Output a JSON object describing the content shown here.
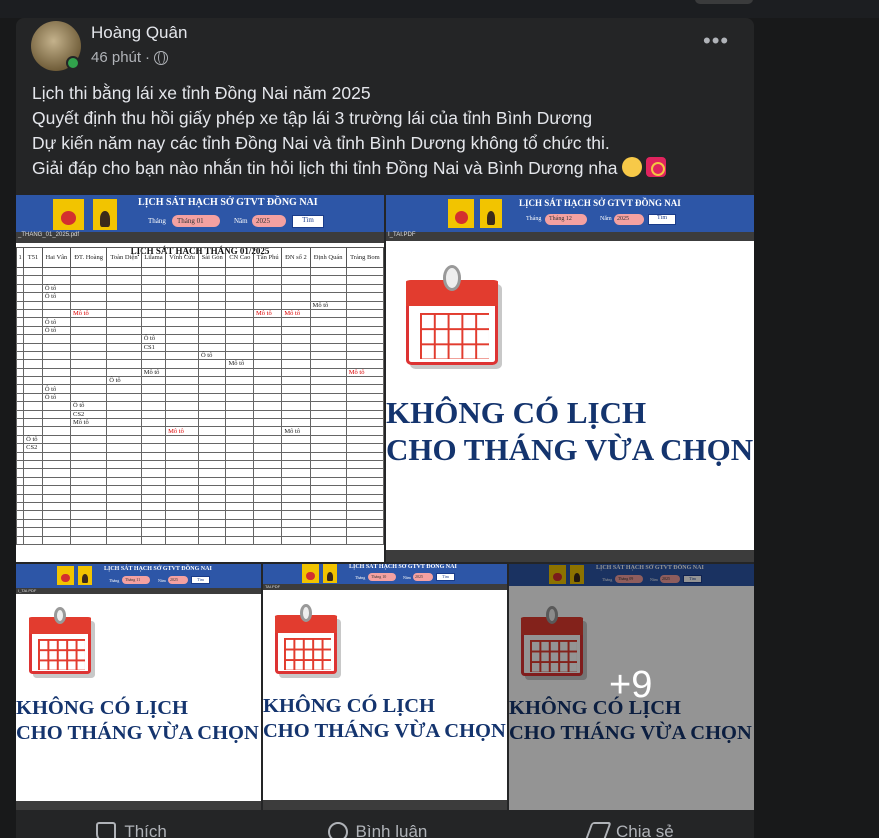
{
  "post": {
    "author": "Hoàng Quân",
    "time": "46 phút",
    "separator": "·",
    "more_label": "•••",
    "lines": [
      "Lịch thi bằng lái xe tỉnh Đồng Nai năm 2025",
      "Quyết định thu hồi giấy phép xe tập lái 3 trường lái của tỉnh Bình Dương",
      "Dự kiến năm nay các tỉnh Đồng Nai và tỉnh Bình Dương không tổ chức thi.",
      "Giải đáp cho bạn nào nhắn tin hỏi lịch thi tỉnh Đồng Nai và Bình Dương nha"
    ],
    "emojis": [
      "grin-emoji",
      "red-envelope-emoji"
    ]
  },
  "site": {
    "title": "LỊCH SÁT HẠCH SỞ GTVT ĐỒNG NAI",
    "home_btn": "Trang chủ",
    "mgr_btn": "Quản lý",
    "month_label": "Tháng",
    "year_label": "Năm",
    "search_btn": "Tìm"
  },
  "images": [
    {
      "month": "Tháng 01",
      "year": "2025",
      "file": "_THANG_01_2025.pdf"
    },
    {
      "month": "Tháng 12",
      "year": "2025",
      "file": "I_TAI.PDF"
    },
    {
      "month": "Tháng 11",
      "year": "2025",
      "file": "I_TAI.PDF"
    },
    {
      "month": "Tháng 10",
      "year": "2025",
      "file": "TAI.PDF"
    },
    {
      "month": "Tháng 09",
      "year": "2025",
      "file": ""
    }
  ],
  "schedule": {
    "title": "LỊCH SÁT HẠCH THÁNG 01/2025",
    "headers": [
      "1",
      "T51",
      "Hai Vân",
      "ĐT. Hoàng",
      "Toàn Diện",
      "Lilama",
      "Vĩnh Cửu",
      "Sài Gòn",
      "CN Cao",
      "Tân Phú",
      "ĐN số 2",
      "Định Quán",
      "Trảng Bom"
    ],
    "rows": [
      [
        "",
        "",
        "",
        "",
        "",
        "",
        "",
        "",
        "",
        "",
        "",
        "",
        ""
      ],
      [
        "",
        "",
        "",
        "",
        "",
        "",
        "",
        "",
        "",
        "",
        "",
        "",
        ""
      ],
      [
        "",
        "",
        "Ô tô",
        "",
        "",
        "",
        "",
        "",
        "",
        "",
        "",
        "",
        ""
      ],
      [
        "",
        "",
        "Ô tô",
        "",
        "",
        "",
        "",
        "",
        "",
        "",
        "",
        "",
        ""
      ],
      [
        "",
        "",
        "",
        "",
        "",
        "",
        "",
        "",
        "",
        "",
        "",
        "Mô tô",
        ""
      ],
      [
        "",
        "",
        "",
        "Mô tô",
        "",
        "",
        "",
        "",
        "",
        "Mô tô",
        "Mô tô",
        "",
        ""
      ],
      [
        "",
        "",
        "Ô tô",
        "",
        "",
        "",
        "",
        "",
        "",
        "",
        "",
        "",
        ""
      ],
      [
        "",
        "",
        "Ô tô",
        "",
        "",
        "",
        "",
        "",
        "",
        "",
        "",
        "",
        ""
      ],
      [
        "",
        "",
        "",
        "",
        "",
        "Ô tô",
        "",
        "",
        "",
        "",
        "",
        "",
        ""
      ],
      [
        "",
        "",
        "",
        "",
        "",
        "CS1",
        "",
        "",
        "",
        "",
        "",
        "",
        ""
      ],
      [
        "",
        "",
        "",
        "",
        "",
        "",
        "",
        "Ô tô",
        "",
        "",
        "",
        "",
        ""
      ],
      [
        "",
        "",
        "",
        "",
        "",
        "",
        "",
        "",
        "Mô tô",
        "",
        "",
        "",
        ""
      ],
      [
        "",
        "",
        "",
        "",
        "",
        "Mô tô",
        "",
        "",
        "",
        "",
        "",
        "",
        "Mô tô"
      ],
      [
        "",
        "",
        "",
        "",
        "Ô tô",
        "",
        "",
        "",
        "",
        "",
        "",
        "",
        ""
      ],
      [
        "",
        "",
        "Ô tô",
        "",
        "",
        "",
        "",
        "",
        "",
        "",
        "",
        "",
        ""
      ],
      [
        "",
        "",
        "Ô tô",
        "",
        "",
        "",
        "",
        "",
        "",
        "",
        "",
        "",
        ""
      ],
      [
        "",
        "",
        "",
        "Ô tô",
        "",
        "",
        "",
        "",
        "",
        "",
        "",
        "",
        ""
      ],
      [
        "",
        "",
        "",
        "CS2",
        "",
        "",
        "",
        "",
        "",
        "",
        "",
        "",
        ""
      ],
      [
        "",
        "",
        "",
        "Mô tô",
        "",
        "",
        "",
        "",
        "",
        "",
        "",
        "",
        ""
      ],
      [
        "",
        "",
        "",
        "",
        "",
        "",
        "Mô tô",
        "",
        "",
        "",
        "Mô tô",
        "",
        ""
      ],
      [
        "",
        "Ô tô",
        "",
        "",
        "",
        "",
        "",
        "",
        "",
        "",
        "",
        "",
        ""
      ],
      [
        "",
        "CS2",
        "",
        "",
        "",
        "",
        "",
        "",
        "",
        "",
        "",
        "",
        ""
      ],
      [
        "",
        "",
        "",
        "",
        "",
        "",
        "",
        "",
        "",
        "",
        "",
        "",
        ""
      ],
      [
        "",
        "",
        "",
        "",
        "",
        "",
        "",
        "",
        "",
        "",
        "",
        "",
        ""
      ],
      [
        "",
        "",
        "",
        "",
        "",
        "",
        "",
        "",
        "",
        "",
        "",
        "",
        ""
      ],
      [
        "",
        "",
        "",
        "",
        "",
        "",
        "",
        "",
        "",
        "",
        "",
        "",
        ""
      ],
      [
        "",
        "",
        "",
        "",
        "",
        "",
        "",
        "",
        "",
        "",
        "",
        "",
        ""
      ],
      [
        "",
        "",
        "",
        "",
        "",
        "",
        "",
        "",
        "",
        "",
        "",
        "",
        ""
      ],
      [
        "",
        "",
        "",
        "",
        "",
        "",
        "",
        "",
        "",
        "",
        "",
        "",
        ""
      ],
      [
        "",
        "",
        "",
        "",
        "",
        "",
        "",
        "",
        "",
        "",
        "",
        "",
        ""
      ],
      [
        "",
        "",
        "",
        "",
        "",
        "",
        "",
        "",
        "",
        "",
        "",
        "",
        ""
      ],
      [
        "",
        "",
        "",
        "",
        "",
        "",
        "",
        "",
        "",
        "",
        "",
        "",
        ""
      ],
      [
        "",
        "",
        "",
        "",
        "",
        "",
        "",
        "",
        "",
        "",
        "",
        "",
        ""
      ]
    ],
    "red_cells": [
      [
        5,
        3
      ],
      [
        5,
        9
      ],
      [
        5,
        10
      ],
      [
        12,
        12
      ],
      [
        19,
        6
      ]
    ]
  },
  "no_schedule": {
    "line1": "KHÔNG CÓ LỊCH",
    "line2": "CHO THÁNG VỪA CHỌN"
  },
  "more_count": "+9",
  "actions": {
    "like": "Thích",
    "comment": "Bình luận",
    "share": "Chia sẻ"
  }
}
